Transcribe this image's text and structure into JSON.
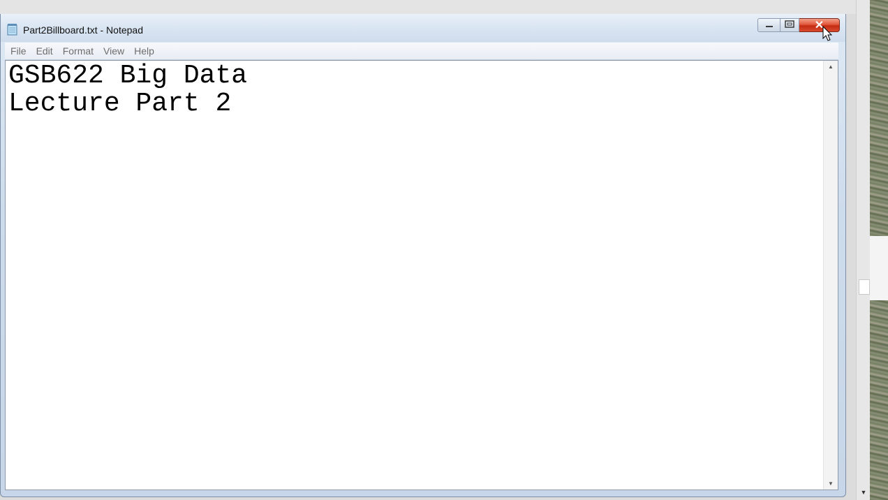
{
  "window": {
    "title": "Part2Billboard.txt - Notepad",
    "caption_buttons": {
      "minimize_icon": "minimize-icon",
      "maximize_icon": "maximize-icon",
      "close_glyph": "✕"
    }
  },
  "menubar": {
    "items": [
      {
        "label": "File"
      },
      {
        "label": "Edit"
      },
      {
        "label": "Format"
      },
      {
        "label": "View"
      },
      {
        "label": "Help"
      }
    ]
  },
  "editor": {
    "text": "GSB622 Big Data\nLecture Part 2"
  },
  "colors": {
    "close_button": "#c32d14",
    "menu_text": "#6d6d6d",
    "frame": "#cddcec"
  }
}
